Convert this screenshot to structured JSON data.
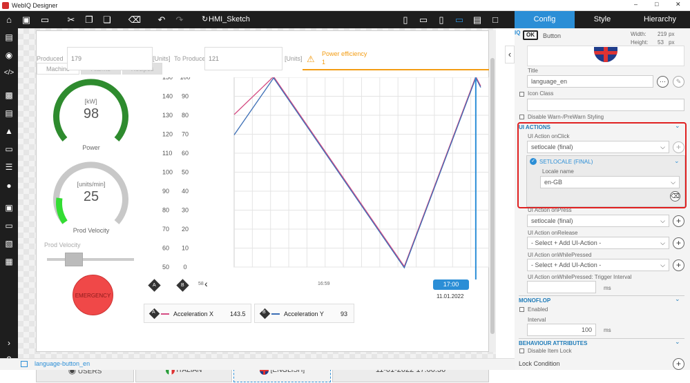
{
  "app": {
    "title": "WebIQ Designer"
  },
  "toolbar": {
    "project": "HMI_Sketch"
  },
  "hmi": {
    "tabs": [
      "Machine",
      "Alarms",
      "Recipes"
    ],
    "produced_label": "Produced",
    "produced_value": "179",
    "units_label": "[Units]",
    "to_produce_label": "To Produce",
    "to_produce_value": "121",
    "units_label2": "[Units]",
    "alert_title": "Power efficiency",
    "alert_value": "1",
    "power_unit": "[kW]",
    "power_value": "98",
    "power_label": "Power",
    "velocity_unit": "[units/min]",
    "velocity_value": "25",
    "velocity_label": "Prod Velocity",
    "slider_label": "Prod Velocity",
    "emergency_label": "EMERGENCY",
    "legend": [
      {
        "badge": "A",
        "name": "Acceleration X",
        "value": "143.5",
        "color": "#d54b82"
      },
      {
        "badge": "B",
        "name": "Acceleration Y",
        "value": "93",
        "color": "#3a6db5"
      }
    ],
    "nav_time": "16:59",
    "cursor_time": "17:00",
    "cursor_date": "11.01.2022",
    "axis_prefix": "58",
    "footer": {
      "users": "USERS",
      "italian": "ITALIAN",
      "english": "[ENGLISH]",
      "datetime": "11-01-2022 17:00:36"
    }
  },
  "chart_data": {
    "type": "line",
    "title": "",
    "xlabel": "",
    "ylabel": "",
    "y_axis_a": {
      "ticks": [
        150,
        140,
        130,
        120,
        110,
        100,
        90,
        80,
        70,
        60,
        50
      ],
      "ylim": [
        50,
        150
      ]
    },
    "y_axis_b": {
      "ticks": [
        100,
        90,
        80,
        70,
        60,
        50,
        40,
        30,
        20,
        10,
        0
      ],
      "ylim": [
        0,
        100
      ]
    },
    "x": [
      0,
      0.16,
      0.69,
      0.98,
      1.0
    ],
    "series": [
      {
        "name": "Acceleration X",
        "values": [
          130,
          150,
          50,
          150,
          145
        ]
      },
      {
        "name": "Acceleration Y",
        "values": [
          70,
          100,
          0,
          100,
          95
        ]
      }
    ],
    "grid": true
  },
  "status": {
    "selected": "language-button_en"
  },
  "panel": {
    "tabs": [
      "Config",
      "Style",
      "Hierarchy"
    ],
    "element_type": "Button",
    "ok_label": "OK",
    "iq": "IQ",
    "width_label": "Width:",
    "width_value": "219",
    "width_unit": "px",
    "height_label": "Height:",
    "height_value": "53",
    "height_unit": "px",
    "title_label": "Title",
    "title_value": "language_en",
    "icon_class": "Icon Class",
    "disable_warn": "Disable Warn-/PreWarn Styling",
    "ui_actions": "UI ACTIONS",
    "onclick_label": "UI Action onClick",
    "onclick_value": "setlocale (final)",
    "setlocale_header": "SETLOCALE (FINAL)",
    "locale_label": "Locale name",
    "locale_value": "en-GB",
    "onpress_label": "UI Action onPress",
    "onpress_value": "setlocale (final)",
    "onrelease_label": "UI Action onRelease",
    "onrelease_value": "- Select + Add UI-Action -",
    "onwhile_label": "UI Action onWhilePressed",
    "onwhile_value": "- Select + Add UI-Action -",
    "trigger_label": "UI Action onWhilePressed: Trigger Interval",
    "ms1": "ms",
    "monoflop": "MONOFLOP",
    "enabled": "Enabled",
    "interval_label": "Interval",
    "interval_value": "100",
    "ms2": "ms",
    "behaviour": "BEHAVIOUR ATTRIBUTES",
    "disable_lock": "Disable Item Lock",
    "lock_condition": "Lock Condition"
  },
  "colors": {
    "accent": "#2b8ed6",
    "dark": "#1e1e1e",
    "highlight": "#e02020",
    "alert": "#f39c12",
    "gauge_power": "#2e8b2e",
    "gauge_velocity": "#33dd33",
    "emergency": "#f04848"
  }
}
